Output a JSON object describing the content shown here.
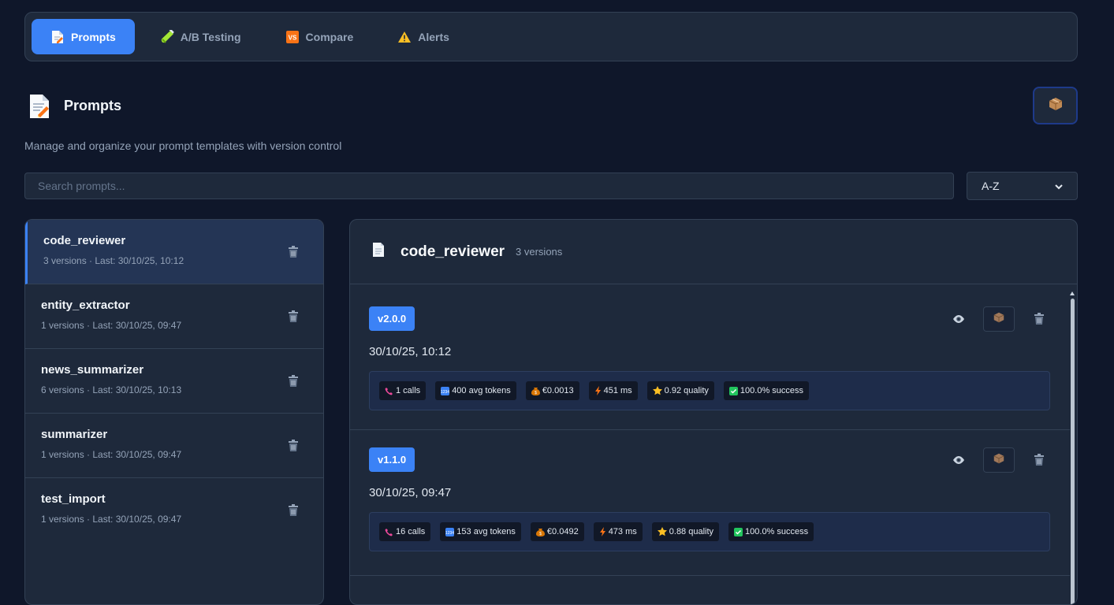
{
  "nav": {
    "tabs": [
      {
        "label": "Prompts",
        "icon": "memo-icon",
        "active": true
      },
      {
        "label": "A/B Testing",
        "icon": "test-tube-icon",
        "active": false
      },
      {
        "label": "Compare",
        "icon": "vs-icon",
        "active": false
      },
      {
        "label": "Alerts",
        "icon": "warning-icon",
        "active": false
      }
    ]
  },
  "header": {
    "title": "Prompts",
    "subtitle": "Manage and organize your prompt templates with version control",
    "export_icon": "package-icon"
  },
  "search": {
    "placeholder": "Search prompts...",
    "value": ""
  },
  "sort": {
    "selected": "A-Z"
  },
  "prompts": [
    {
      "name": "code_reviewer",
      "meta": "3 versions · Last: 30/10/25, 10:12",
      "active": true
    },
    {
      "name": "entity_extractor",
      "meta": "1 versions · Last: 30/10/25, 09:47",
      "active": false
    },
    {
      "name": "news_summarizer",
      "meta": "6 versions · Last: 30/10/25, 10:13",
      "active": false
    },
    {
      "name": "summarizer",
      "meta": "1 versions · Last: 30/10/25, 09:47",
      "active": false
    },
    {
      "name": "test_import",
      "meta": "1 versions · Last: 30/10/25, 09:47",
      "active": false
    }
  ],
  "detail": {
    "title": "code_reviewer",
    "count": "3 versions",
    "versions": [
      {
        "version": "v2.0.0",
        "date": "30/10/25, 10:12",
        "stats": {
          "calls": "1 calls",
          "tokens": "400 avg tokens",
          "cost": "€0.0013",
          "latency": "451 ms",
          "quality": "0.92 quality",
          "success": "100.0% success"
        }
      },
      {
        "version": "v1.1.0",
        "date": "30/10/25, 09:47",
        "stats": {
          "calls": "16 calls",
          "tokens": "153 avg tokens",
          "cost": "€0.0492",
          "latency": "473 ms",
          "quality": "0.88 quality",
          "success": "100.0% success"
        }
      }
    ]
  },
  "colors": {
    "background": "#0f172a",
    "panel": "#1e293b",
    "accent": "#3b82f6",
    "border": "#334155"
  }
}
